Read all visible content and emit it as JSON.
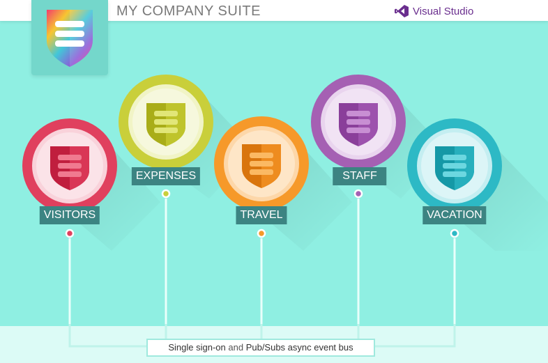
{
  "header": {
    "app_title": "MY COMPANY SUITE",
    "vs_brand": "Visual Studio"
  },
  "apps": [
    {
      "label": "VISITORS",
      "color": "#e0405e"
    },
    {
      "label": "EXPENSES",
      "color": "#c9cf3a"
    },
    {
      "label": "TRAVEL",
      "color": "#f6992a"
    },
    {
      "label": "STAFF",
      "color": "#a560b3"
    },
    {
      "label": "VACATION",
      "color": "#2db9c5"
    }
  ],
  "bus": {
    "part1": "Single sign-on",
    "part2": " and ",
    "part3": "Pub/Subs async event bus"
  },
  "colors": {
    "background": "#8fefe2",
    "label_bg": "#3c8482",
    "brand_purple": "#6a2e8e"
  },
  "icons": [
    "shield-icon",
    "visual-studio-icon"
  ]
}
